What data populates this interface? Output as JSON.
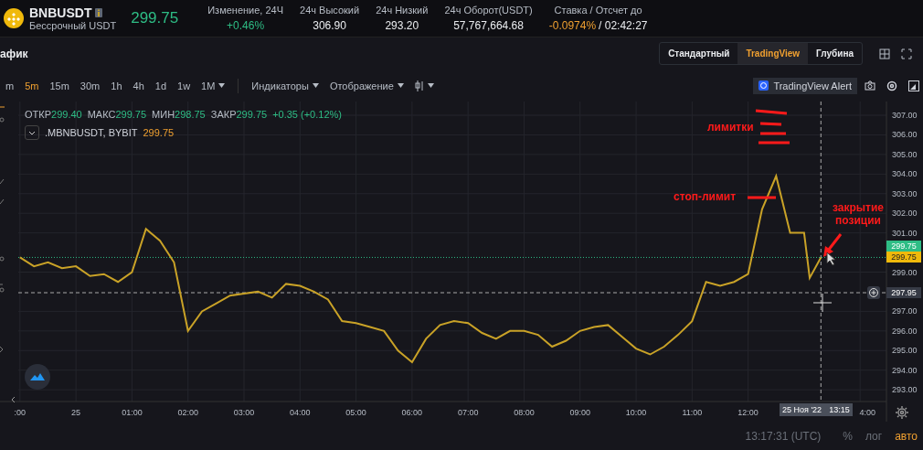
{
  "header": {
    "symbol": "BNBUSDT",
    "subtitle": "Бессрочный USDT",
    "price": "299.75",
    "stats": [
      {
        "label": "Изменение, 24Ч",
        "value": "+0.46%",
        "color": "#2ebd85"
      },
      {
        "label": "24ч Высокий",
        "value": "306.90"
      },
      {
        "label": "24ч Низкий",
        "value": "293.20"
      },
      {
        "label": "24ч Оборот(USDT)",
        "value": "57,767,664.68"
      },
      {
        "label": "Ставка / Отсчет до",
        "value": "-0.0974%",
        "color": "#f0a030",
        "extra": "/ 02:42:27"
      }
    ]
  },
  "panel": {
    "title": "афик",
    "views": [
      {
        "label": "Стандартный",
        "selected": false
      },
      {
        "label": "TradingView",
        "selected": true
      },
      {
        "label": "Глубина",
        "selected": false
      }
    ]
  },
  "toolbar": {
    "intervals": [
      {
        "label": "m",
        "selected": false,
        "menu": false
      },
      {
        "label": "5m",
        "selected": true,
        "menu": false
      },
      {
        "label": "15m",
        "selected": false,
        "menu": false
      },
      {
        "label": "30m",
        "selected": false,
        "menu": false
      },
      {
        "label": "1h",
        "selected": false,
        "menu": false
      },
      {
        "label": "4h",
        "selected": false,
        "menu": false
      },
      {
        "label": "1d",
        "selected": false,
        "menu": false
      },
      {
        "label": "1w",
        "selected": false,
        "menu": false
      },
      {
        "label": "1M",
        "selected": false,
        "menu": true
      }
    ],
    "menus": [
      "Индикаторы",
      "Отображение"
    ],
    "alert": "TradingView Alert"
  },
  "legend": {
    "fields": [
      {
        "label": "ОТКР",
        "value": "299.40"
      },
      {
        "label": "МАКС",
        "value": "299.75"
      },
      {
        "label": "МИН",
        "value": "298.75"
      },
      {
        "label": "ЗАКР",
        "value": "299.75"
      }
    ],
    "change": "+0.35 (+0.12%)",
    "source": ".MBNBUSDT, BYBIT",
    "last": "299.75"
  },
  "chart": {
    "chart_data": {
      "type": "line",
      "grid": true,
      "x": [
        -1,
        -0.75,
        -0.5,
        -0.25,
        0,
        0.25,
        0.5,
        0.75,
        1,
        1.25,
        1.5,
        1.75,
        2,
        2.25,
        2.5,
        2.75,
        3,
        3.25,
        3.5,
        3.75,
        4,
        4.25,
        4.5,
        4.75,
        5,
        5.25,
        5.5,
        5.75,
        6,
        6.25,
        6.5,
        6.75,
        7,
        7.25,
        7.5,
        7.75,
        8,
        8.25,
        8.5,
        8.75,
        9,
        9.25,
        9.5,
        9.75,
        10,
        10.25,
        10.5,
        10.75,
        11,
        11.25,
        11.5,
        11.75,
        12,
        12.25,
        12.5,
        12.75,
        13,
        13.1,
        13.3
      ],
      "series": [
        {
          "color": "#c9a227",
          "values": [
            299.75,
            299.3,
            299.5,
            299.2,
            299.3,
            298.8,
            298.9,
            298.5,
            299.0,
            301.2,
            300.6,
            299.5,
            296.0,
            297.0,
            297.4,
            297.8,
            297.9,
            298.0,
            297.7,
            298.4,
            298.3,
            298.0,
            297.6,
            296.5,
            296.4,
            296.2,
            296.0,
            295.0,
            294.4,
            295.6,
            296.3,
            296.5,
            296.4,
            295.9,
            295.6,
            296.0,
            296.0,
            295.8,
            295.2,
            295.5,
            296.0,
            296.2,
            296.3,
            295.7,
            295.1,
            294.8,
            295.2,
            295.8,
            296.5,
            298.5,
            298.3,
            298.5,
            298.9,
            302.2,
            303.9,
            301.0,
            301.0,
            298.7,
            299.75
          ]
        }
      ],
      "xlim": [
        -1.03,
        14.47
      ],
      "ylim": [
        292.4,
        307.7
      ],
      "yticks": [
        {
          "value": 293,
          "label": "293.00"
        },
        {
          "value": 294,
          "label": "294.00"
        },
        {
          "value": 295,
          "label": "295.00"
        },
        {
          "value": 296,
          "label": "296.00"
        },
        {
          "value": 297,
          "label": "297.00"
        },
        {
          "value": 299,
          "label": "299.00"
        },
        {
          "value": 301,
          "label": "301.00"
        },
        {
          "value": 302,
          "label": "302.00"
        },
        {
          "value": 303,
          "label": "303.00"
        },
        {
          "value": 304,
          "label": "304.00"
        },
        {
          "value": 305,
          "label": "305.00"
        },
        {
          "value": 306,
          "label": "306.00"
        },
        {
          "value": 307,
          "label": "307.00"
        }
      ],
      "xticks": [
        {
          "value": 1,
          "label": "01:00"
        },
        {
          "value": 2,
          "label": "02:00"
        },
        {
          "value": 3,
          "label": "03:00"
        },
        {
          "value": 4,
          "label": "04:00"
        },
        {
          "value": 5,
          "label": "05:00"
        },
        {
          "value": 6,
          "label": "06:00"
        },
        {
          "value": 7,
          "label": "07:00"
        },
        {
          "value": 8,
          "label": "08:00"
        },
        {
          "value": 9,
          "label": "09:00"
        },
        {
          "value": 10,
          "label": "10:00"
        },
        {
          "value": 11,
          "label": "11:00"
        },
        {
          "value": 12,
          "label": "12:00"
        }
      ],
      "ref_lines": [
        {
          "axis": "y",
          "value": 299.75,
          "color": "#2ebd85"
        },
        {
          "axis": "y",
          "value": 297.95,
          "color": "#aaaaaa"
        },
        {
          "axis": "x",
          "value": 13.3,
          "color": "#aaaaaa"
        }
      ]
    },
    "time_labels": [
      ":00",
      "25",
      "4:00"
    ],
    "price_labels": [
      {
        "text": "299.75",
        "kind": "last"
      },
      {
        "text": "299.75",
        "kind": "close"
      },
      {
        "text": "297.95",
        "kind": "crosshair"
      }
    ],
    "crosshair": {
      "date": "25 Ноя '22",
      "time": "13:15"
    },
    "notes": [
      "лимитки",
      "стоп-лимит",
      "закрытие позиции"
    ]
  },
  "footer": {
    "clock": "13:17:31 (UTC)",
    "scales": [
      {
        "label": "%",
        "selected": false
      },
      {
        "label": "лог",
        "selected": false
      },
      {
        "label": "авто",
        "selected": true
      }
    ]
  }
}
